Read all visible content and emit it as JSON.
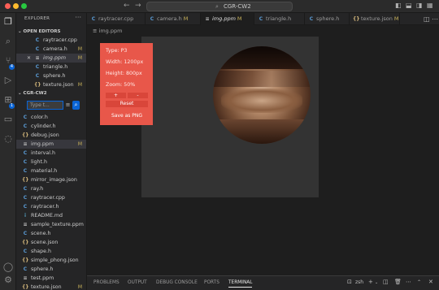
{
  "window": {
    "title": "CGR-CW2"
  },
  "titlebar": {
    "back_icon": "arrow-left-icon",
    "forward_icon": "arrow-right-icon"
  },
  "sidebar": {
    "title": "EXPLORER",
    "open_editors_label": "OPEN EDITORS",
    "open_editors": [
      {
        "name": "raytracer.cpp",
        "icon": "C",
        "modified": ""
      },
      {
        "name": "camera.h",
        "icon": "C",
        "modified": "M"
      },
      {
        "name": "img.ppm",
        "icon": "≡",
        "modified": "M"
      },
      {
        "name": "triangle.h",
        "icon": "C",
        "modified": ""
      },
      {
        "name": "sphere.h",
        "icon": "C",
        "modified": ""
      },
      {
        "name": "texture.json",
        "icon": "{}",
        "modified": "M"
      }
    ],
    "project_label": "CGR-CW2",
    "search_placeholder": "Type t...",
    "files": [
      {
        "name": "color.h",
        "icon": "C",
        "modified": ""
      },
      {
        "name": "cylinder.h",
        "icon": "C",
        "modified": ""
      },
      {
        "name": "debug.json",
        "icon": "{}",
        "modified": ""
      },
      {
        "name": "img.ppm",
        "icon": "≡",
        "modified": "M"
      },
      {
        "name": "interval.h",
        "icon": "C",
        "modified": ""
      },
      {
        "name": "light.h",
        "icon": "C",
        "modified": ""
      },
      {
        "name": "material.h",
        "icon": "C",
        "modified": ""
      },
      {
        "name": "mirror_image.json",
        "icon": "{}",
        "modified": ""
      },
      {
        "name": "ray.h",
        "icon": "C",
        "modified": ""
      },
      {
        "name": "raytracer.cpp",
        "icon": "C",
        "modified": ""
      },
      {
        "name": "raytracer.h",
        "icon": "C",
        "modified": ""
      },
      {
        "name": "README.md",
        "icon": "i",
        "modified": ""
      },
      {
        "name": "sample_texture.ppm",
        "icon": "≡",
        "modified": ""
      },
      {
        "name": "scene.h",
        "icon": "C",
        "modified": ""
      },
      {
        "name": "scene.json",
        "icon": "{}",
        "modified": ""
      },
      {
        "name": "shape.h",
        "icon": "C",
        "modified": ""
      },
      {
        "name": "simple_phong.json",
        "icon": "{}",
        "modified": ""
      },
      {
        "name": "sphere.h",
        "icon": "C",
        "modified": ""
      },
      {
        "name": "test.ppm",
        "icon": "≡",
        "modified": ""
      },
      {
        "name": "texture.json",
        "icon": "{}",
        "modified": "M"
      }
    ]
  },
  "tabs": [
    {
      "label": "raytracer.cpp",
      "icon": "C",
      "modified": ""
    },
    {
      "label": "camera.h",
      "icon": "C",
      "modified": "M"
    },
    {
      "label": "img.ppm",
      "icon": "≡",
      "modified": "M"
    },
    {
      "label": "triangle.h",
      "icon": "C",
      "modified": ""
    },
    {
      "label": "sphere.h",
      "icon": "C",
      "modified": ""
    },
    {
      "label": "texture.json",
      "icon": "{}",
      "modified": "M"
    }
  ],
  "breadcrumb": "img.ppm",
  "viewer_panel": {
    "type": "Type: P3",
    "width": "Width: 1200px",
    "height": "Height: 800px",
    "zoom": "Zoom: 50%",
    "zoom_in": "+",
    "zoom_out": "-",
    "reset": "Reset",
    "save": "Save as PNG"
  },
  "bottom_panel": {
    "tabs": [
      "PROBLEMS",
      "OUTPUT",
      "DEBUG CONSOLE",
      "PORTS",
      "TERMINAL"
    ],
    "shell": "zsh"
  },
  "colors": {
    "accent": "#0a64d6",
    "panel": "#e8574a",
    "modified": "#c9b25a"
  }
}
